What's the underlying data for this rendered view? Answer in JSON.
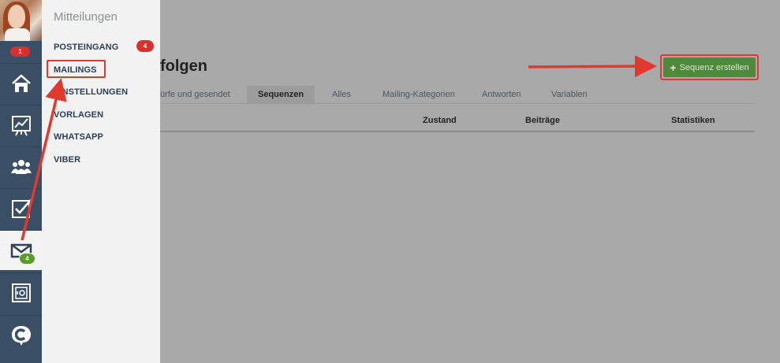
{
  "sidebar": {
    "notification_badge": "1",
    "mail_badge": "4",
    "icons": [
      "home-icon",
      "chart-icon",
      "users-icon",
      "tasks-icon",
      "mail-icon",
      "safe-icon",
      "brand-c-icon"
    ]
  },
  "flyout": {
    "title": "Mitteilungen",
    "items": [
      {
        "label": "POSTEINGANG",
        "badge": "4"
      },
      {
        "label": "MAILINGS"
      },
      {
        "label": "EINSTELLUNGEN"
      },
      {
        "label": "VORLAGEN"
      },
      {
        "label": "WHATSAPP"
      },
      {
        "label": "VIBER"
      }
    ]
  },
  "main": {
    "page_title": "folgen",
    "create_button_label": "Sequenz erstellen",
    "tabs": [
      {
        "label": "ürfe und gesendet"
      },
      {
        "label": "Sequenzen",
        "active": true
      },
      {
        "label": "Alles"
      },
      {
        "label": "Mailing-Kategorien"
      },
      {
        "label": "Antworten"
      },
      {
        "label": "Variablen"
      }
    ],
    "columns": [
      "Zustand",
      "Beiträge",
      "Statistiken"
    ]
  },
  "colors": {
    "rail": "#3a4f66",
    "accent_green": "#4e8a3a",
    "highlight_red": "#e03a2f",
    "badge_red": "#d9302d",
    "badge_green": "#5b9a2d",
    "overlay": "#a9a9a9"
  }
}
